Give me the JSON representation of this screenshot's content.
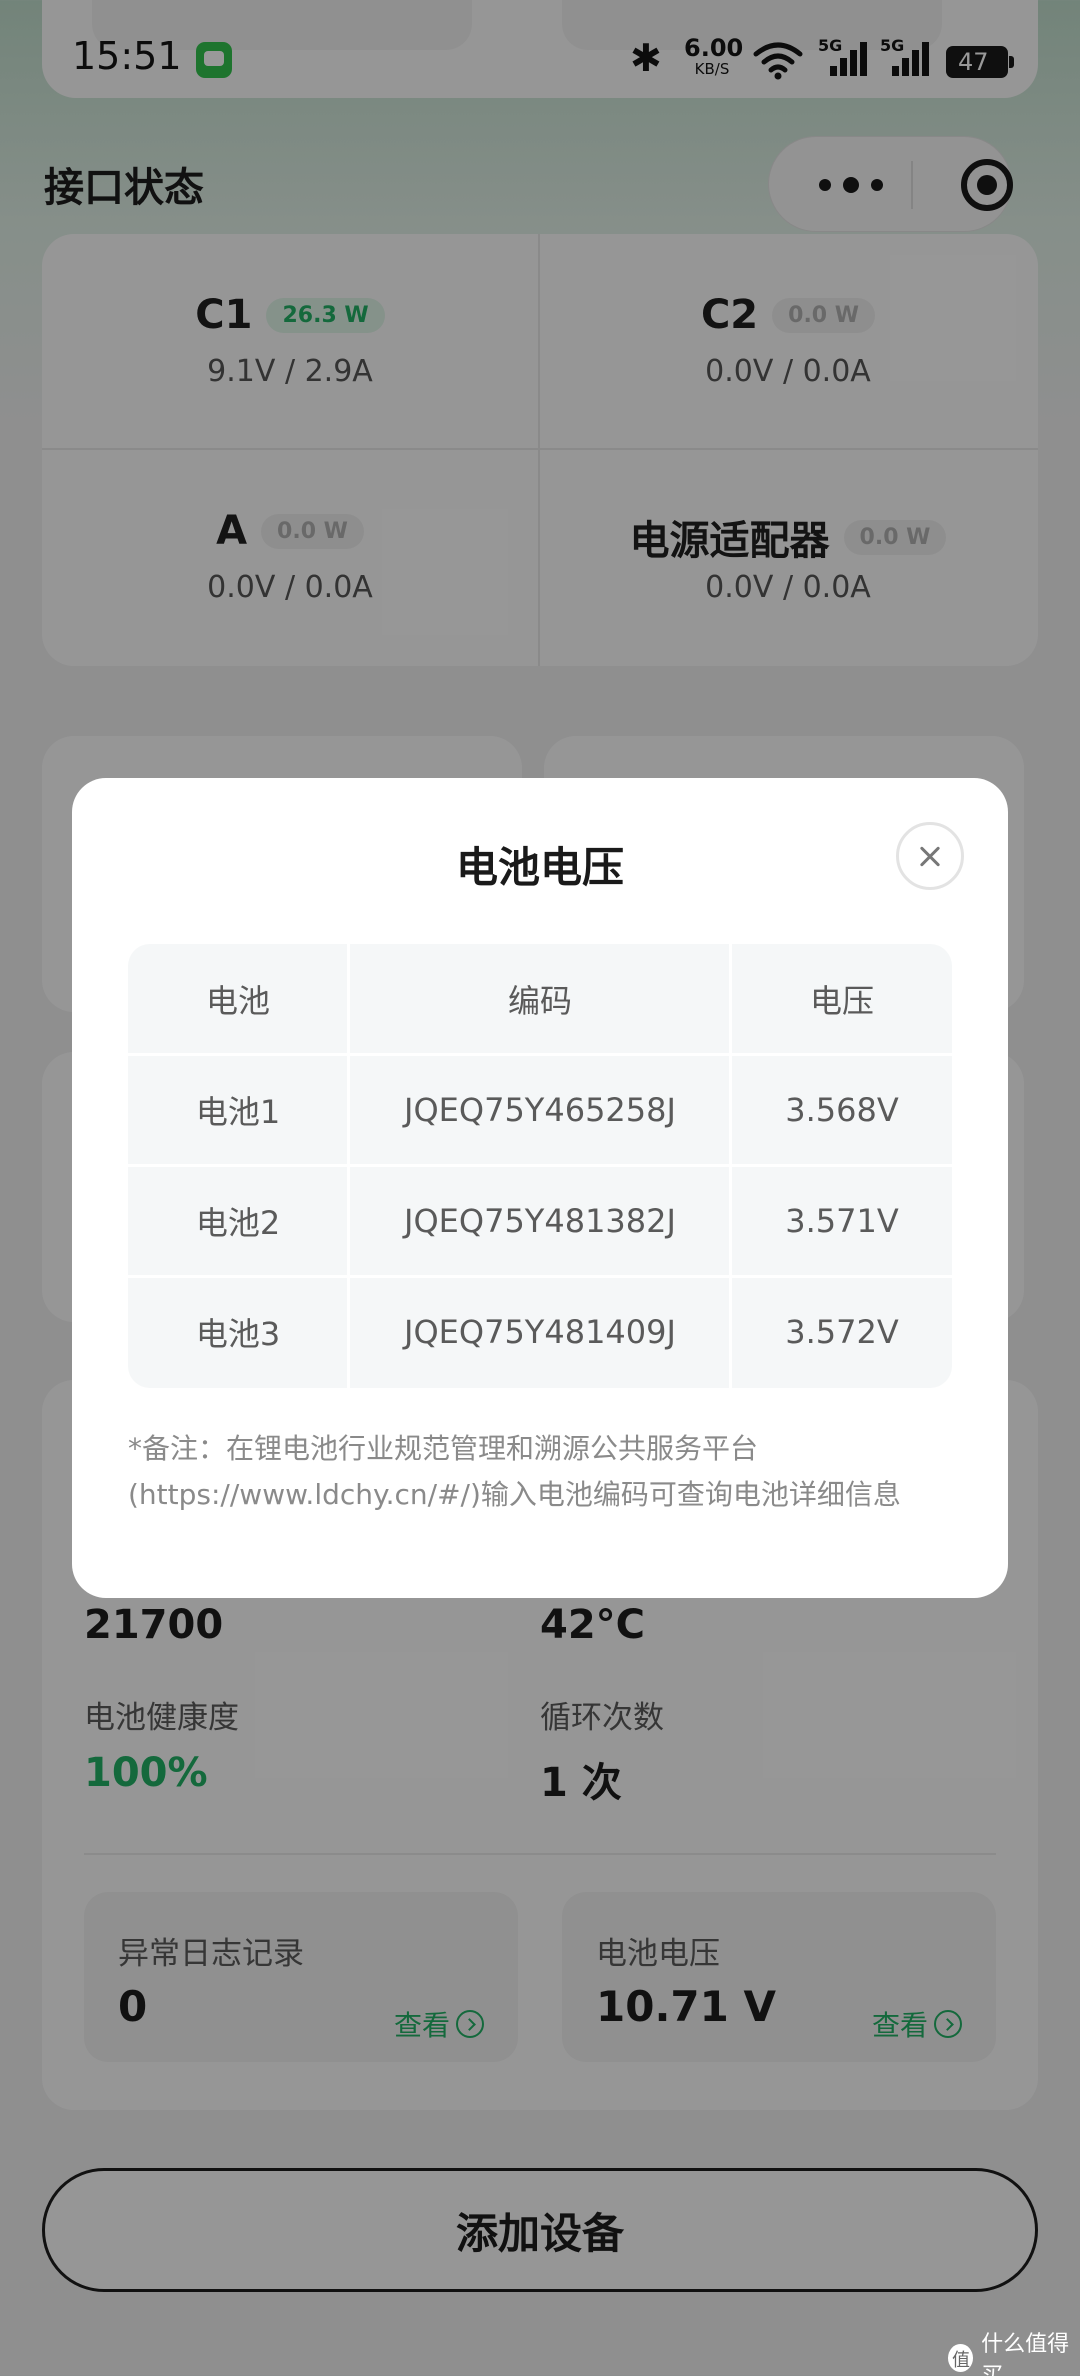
{
  "status_bar": {
    "time": "15:51",
    "net_speed_value": "6.00",
    "net_speed_unit": "KB/S",
    "signal_tag_1": "5G",
    "signal_tag_2": "5G",
    "battery": "47"
  },
  "header": {
    "section_title": "接口状态"
  },
  "ports": [
    {
      "name": "C1",
      "power": "26.3 W",
      "vi": "9.1V / 2.9A",
      "active": true
    },
    {
      "name": "C2",
      "power": "0.0 W",
      "vi": "0.0V / 0.0A",
      "active": false
    },
    {
      "name": "A",
      "power": "0.0 W",
      "vi": "0.0V / 0.0A",
      "active": false
    },
    {
      "name": "电源适配器",
      "power": "0.0 W",
      "vi": "0.0V / 0.0A",
      "active": false
    }
  ],
  "battery_info": {
    "model_value": "21700",
    "temp_value": "42°C",
    "health_label": "电池健康度",
    "health_value": "100%",
    "cycles_label": "循环次数",
    "cycles_value": "1 次",
    "log_card": {
      "title": "异常日志记录",
      "value": "0",
      "link": "查看"
    },
    "voltage_card": {
      "title": "电池电压",
      "value": "10.71 V",
      "link": "查看"
    }
  },
  "add_device_label": "添加设备",
  "modal": {
    "title": "电池电压",
    "columns": [
      "电池",
      "编码",
      "电压"
    ],
    "rows": [
      [
        "电池1",
        "JQEQ75Y465258J",
        "3.568V"
      ],
      [
        "电池2",
        "JQEQ75Y481382J",
        "3.571V"
      ],
      [
        "电池3",
        "JQEQ75Y481409J",
        "3.572V"
      ]
    ],
    "note_line1": "*备注：在锂电池行业规范管理和溯源公共服务平台",
    "note_line2": "(https://www.ldchy.cn/#/)输入电池编码可查询电池详细信息"
  },
  "watermark": "什么值得买",
  "colors": {
    "accent_green": "#22b065",
    "overlay": "rgba(0,0,0,0.40)"
  }
}
